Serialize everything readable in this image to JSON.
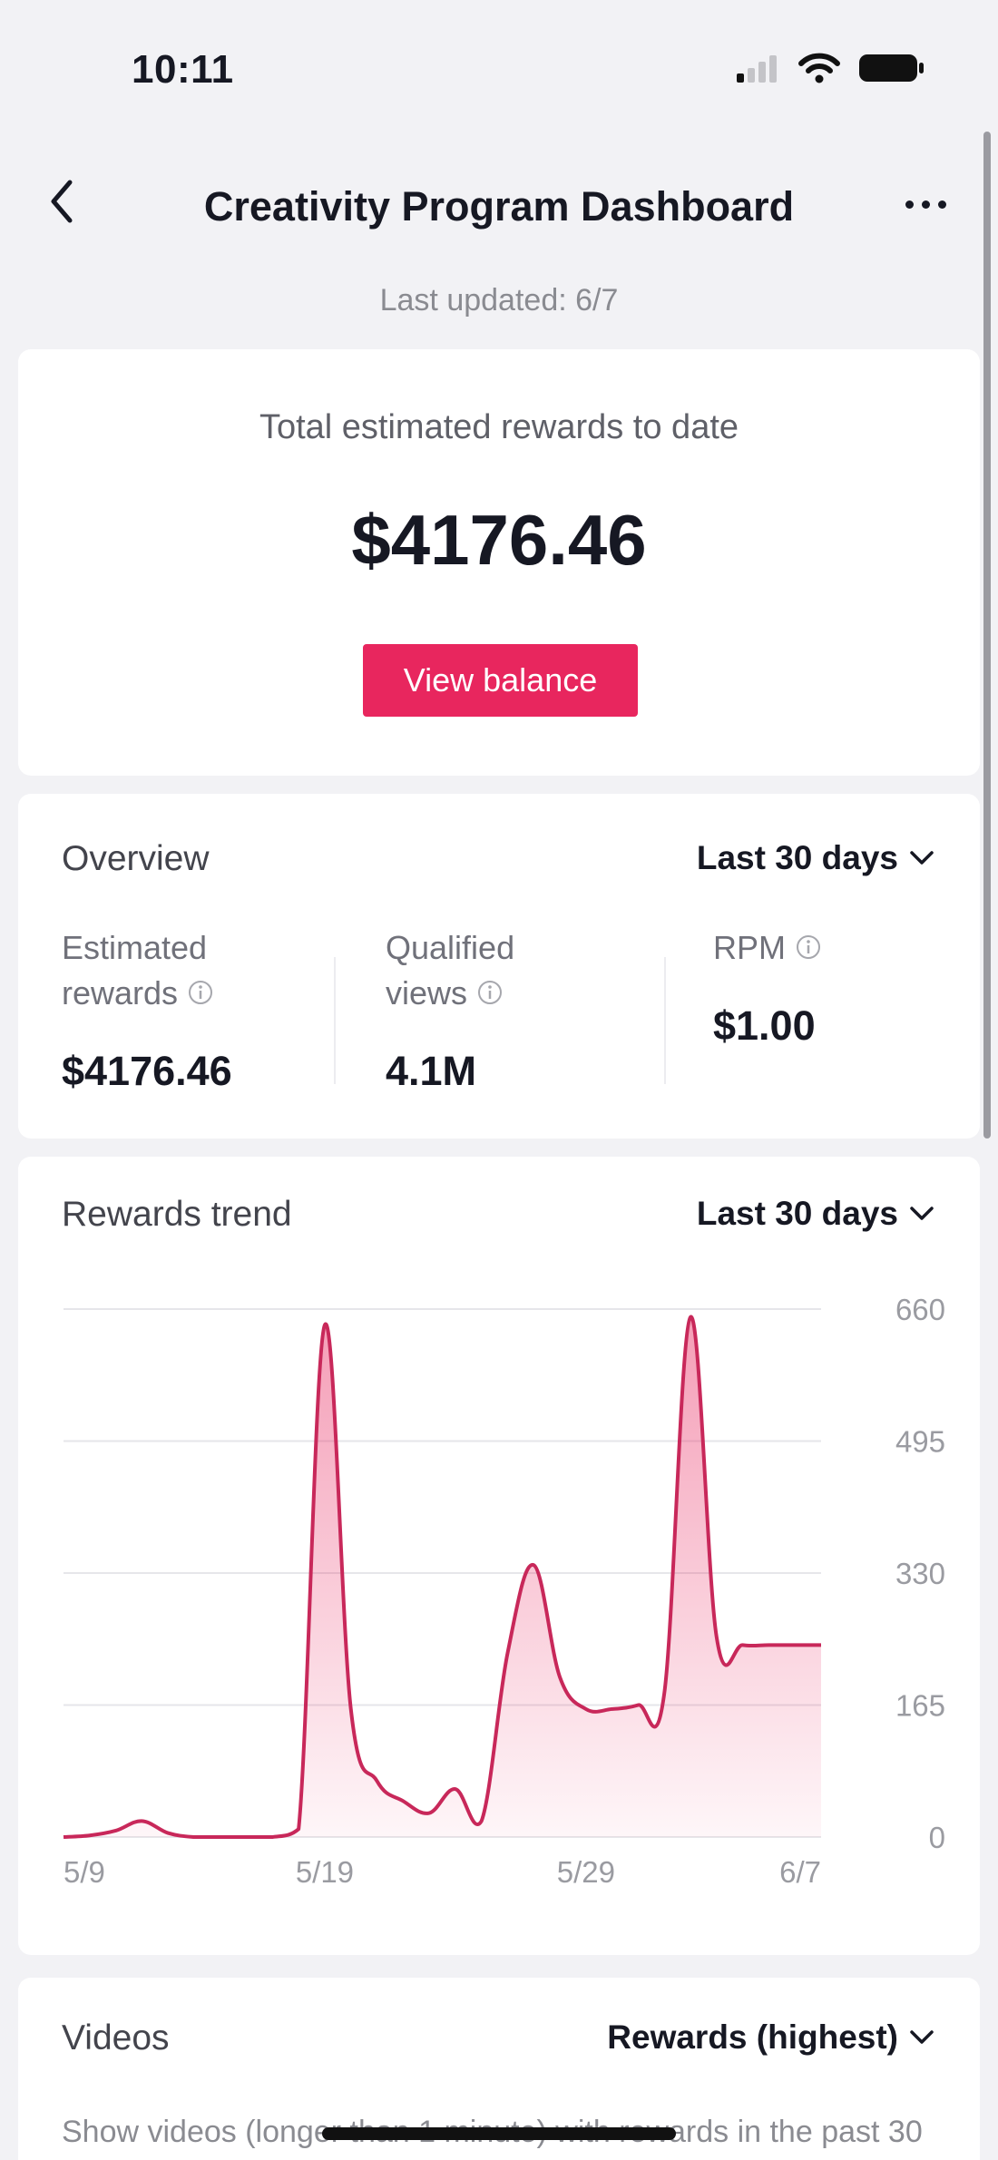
{
  "status_bar": {
    "time": "10:11"
  },
  "header": {
    "title": "Creativity Program Dashboard",
    "last_updated": "Last updated: 6/7"
  },
  "total_card": {
    "label": "Total estimated rewards to date",
    "value": "$4176.46",
    "button_label": "View balance"
  },
  "overview": {
    "title": "Overview",
    "range": "Last 30 days",
    "metrics": [
      {
        "label_line1": "Estimated",
        "label_line2": "rewards",
        "value": "$4176.46"
      },
      {
        "label_line1": "Qualified",
        "label_line2": "views",
        "value": "4.1M"
      },
      {
        "label_line1": "RPM",
        "label_line2": "",
        "value": "$1.00"
      }
    ]
  },
  "rewards_trend": {
    "title": "Rewards trend",
    "range": "Last 30 days"
  },
  "videos": {
    "title": "Videos",
    "sort": "Rewards (highest)",
    "note": "Show videos (longer than 1 minute) with rewards in the past 30 days"
  },
  "colors": {
    "accent": "#e8265e",
    "line": "#c8285a",
    "background": "#f2f2f5"
  },
  "chart_data": {
    "type": "area",
    "x_tick_labels": [
      "5/9",
      "5/19",
      "5/29",
      "6/7"
    ],
    "y_tick_labels": [
      "0",
      "165",
      "330",
      "495",
      "660"
    ],
    "ylim": [
      0,
      660
    ],
    "grid": true,
    "series": [
      {
        "x": [
          "5/9",
          "5/10",
          "5/11",
          "5/12",
          "5/13",
          "5/14",
          "5/15",
          "5/16",
          "5/17",
          "5/18",
          "5/19",
          "5/20",
          "5/21",
          "5/22",
          "5/23",
          "5/24",
          "5/25",
          "5/26",
          "5/27",
          "5/28",
          "5/29",
          "5/30",
          "5/31",
          "6/1",
          "6/2",
          "6/3",
          "6/4",
          "6/5",
          "6/6",
          "6/7"
        ],
        "values": [
          0,
          2,
          8,
          20,
          5,
          0,
          0,
          0,
          0,
          10,
          640,
          160,
          70,
          45,
          30,
          60,
          20,
          230,
          340,
          200,
          160,
          160,
          165,
          180,
          650,
          250,
          240,
          240,
          240,
          240
        ]
      }
    ]
  }
}
